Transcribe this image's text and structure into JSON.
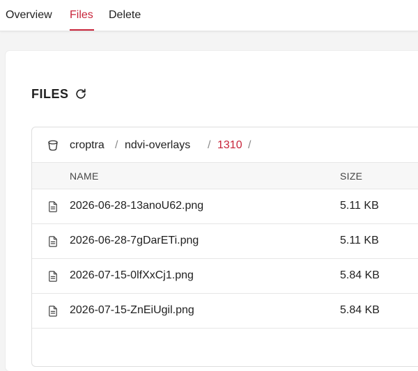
{
  "tabs": [
    {
      "label": "Overview",
      "active": false
    },
    {
      "label": "Files",
      "active": true
    },
    {
      "label": "Delete",
      "active": false
    }
  ],
  "accent_color": "#c8243a",
  "section": {
    "title": "FILES",
    "refresh_icon": "refresh-icon"
  },
  "breadcrumb": {
    "icon": "bucket-icon",
    "items": [
      "croptra",
      "ndvi-overlays",
      "1310"
    ],
    "separator": "/"
  },
  "table": {
    "columns": [
      "NAME",
      "SIZE"
    ],
    "rows": [
      {
        "name": "2026-06-28-13anoU62.png",
        "size": "5.11 KB",
        "icon": "file-icon"
      },
      {
        "name": "2026-06-28-7gDarETi.png",
        "size": "5.11 KB",
        "icon": "file-icon"
      },
      {
        "name": "2026-07-15-0lfXxCj1.png",
        "size": "5.84 KB",
        "icon": "file-icon"
      },
      {
        "name": "2026-07-15-ZnEiUgil.png",
        "size": "5.84 KB",
        "icon": "file-icon"
      }
    ]
  }
}
